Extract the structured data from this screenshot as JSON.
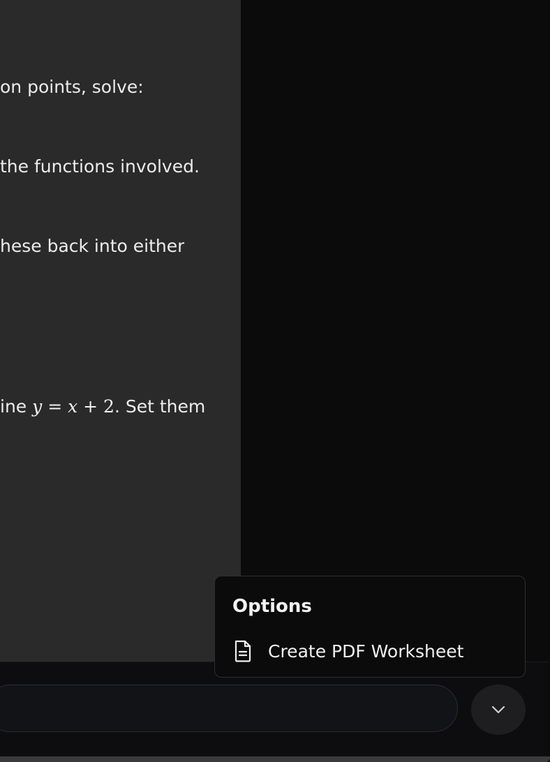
{
  "content": {
    "lines": [
      "on points, solve:",
      " the functions involved.",
      "hese back into either"
    ],
    "equation_line": {
      "prefix": "ine ",
      "math_y": "y",
      "math_eq": " = ",
      "math_x": "x",
      "math_plus": " + ",
      "math_two": "2",
      "suffix": ". Set them"
    }
  },
  "options_menu": {
    "title": "Options",
    "items": [
      {
        "label": "Create PDF Worksheet",
        "icon": "document-icon"
      }
    ]
  },
  "composer": {
    "placeholder": "",
    "toggle_icon": "chevron-down-icon"
  }
}
